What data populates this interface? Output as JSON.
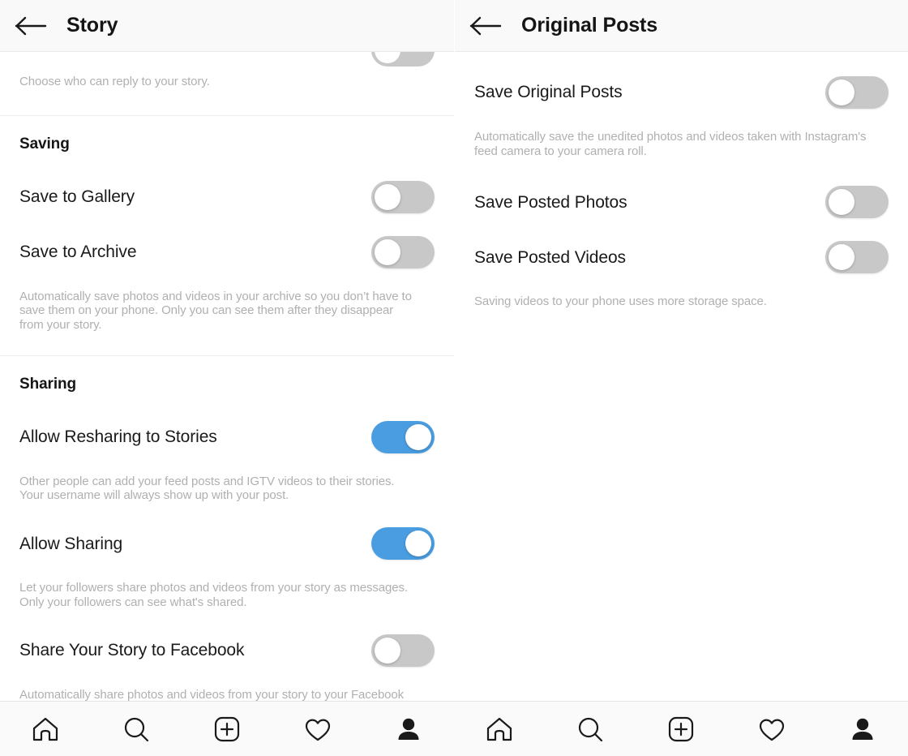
{
  "left_pane": {
    "header": {
      "title": "Story",
      "back_icon": "arrow-left-icon"
    },
    "top_partial_description": "Choose who can reply to your story.",
    "sections": [
      {
        "title": "Saving",
        "rows": [
          {
            "label": "Save to Gallery",
            "toggle": "off"
          },
          {
            "label": "Save to Archive",
            "toggle": "off"
          }
        ],
        "description": "Automatically save photos and videos in your archive so you don’t have to save them on your phone. Only you can see them after they disappear from your story."
      },
      {
        "title": "Sharing",
        "rows": [
          {
            "label": "Allow Resharing to Stories",
            "toggle": "on",
            "description": "Other people can add your feed posts and IGTV videos to their stories. Your username will always show up with your post."
          },
          {
            "label": "Allow Sharing",
            "toggle": "on",
            "description": "Let your followers share photos and videos from your story as messages. Only your followers can see what's shared."
          },
          {
            "label": "Share Your Story to Facebook",
            "toggle": "off",
            "description": "Automatically share photos and videos from your story to your Facebook story."
          }
        ]
      }
    ]
  },
  "right_pane": {
    "header": {
      "title": "Original Posts",
      "back_icon": "arrow-left-icon"
    },
    "rows": [
      {
        "label": "Save Original Posts",
        "toggle": "off",
        "description": "Automatically save the unedited photos and videos taken with Instagram's feed camera to your camera roll."
      },
      {
        "label": "Save Posted Photos",
        "toggle": "off"
      },
      {
        "label": "Save Posted Videos",
        "toggle": "off"
      }
    ],
    "footer_description": "Saving videos to your phone uses more storage space."
  },
  "bottom_nav": {
    "items": [
      {
        "icon": "home-icon",
        "label": "Home"
      },
      {
        "icon": "search-icon",
        "label": "Search"
      },
      {
        "icon": "add-post-icon",
        "label": "New Post"
      },
      {
        "icon": "heart-icon",
        "label": "Activity"
      },
      {
        "icon": "profile-icon",
        "label": "Profile",
        "active": true
      }
    ]
  },
  "colors": {
    "toggle_on": "#4a9de0",
    "toggle_off": "#c8c8c8",
    "header_bg": "#f9f9f9",
    "label_text": "#1a1a1a",
    "description_text": "#b0b0b0"
  }
}
